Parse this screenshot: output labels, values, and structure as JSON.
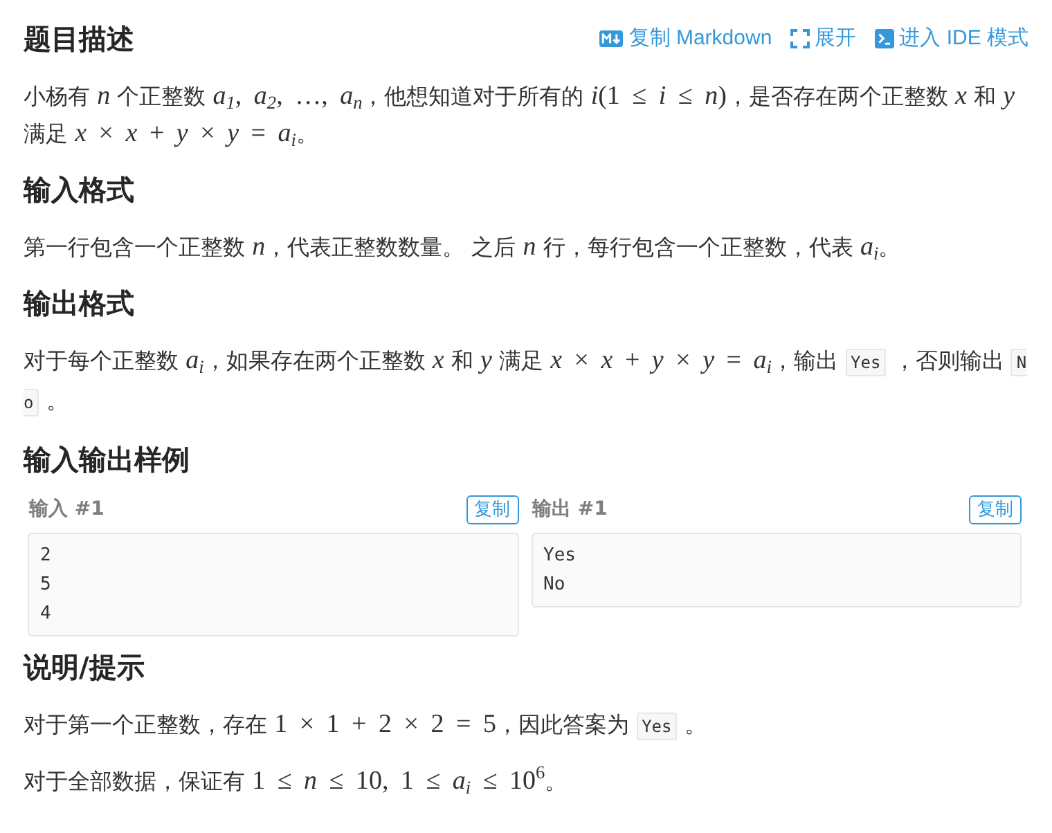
{
  "sections": [
    {
      "kind": "text",
      "title": "题目描述",
      "actions": [
        {
          "kind": "markdown",
          "label": "复制 Markdown"
        },
        {
          "kind": "expand",
          "label": "展开"
        },
        {
          "kind": "ide",
          "label": "进入 IDE 模式"
        }
      ],
      "paragraphs": [
        [
          {
            "kind": "text",
            "text": "小杨有 "
          },
          {
            "kind": "math",
            "text": "*n*"
          },
          {
            "kind": "text",
            "text": " 个正整数 "
          },
          {
            "kind": "math",
            "text": "*a*$_{1}$, *a*$_{2}$, …, *a*$_{n}$"
          },
          {
            "kind": "text",
            "text": "，他想知道对于所有的 "
          },
          {
            "kind": "math",
            "text": "*i*(1 ≤ *i* ≤ *n*)"
          },
          {
            "kind": "text",
            "text": "，是否存在两个正整数 "
          },
          {
            "kind": "math",
            "text": "*x*"
          },
          {
            "kind": "text",
            "text": " 和 "
          },
          {
            "kind": "math",
            "text": "*y*"
          },
          {
            "kind": "text",
            "text": " 满足 "
          },
          {
            "kind": "math",
            "text": "*x* × *x* + *y* × *y* = *a*$_{i}$"
          },
          {
            "kind": "text",
            "text": "。"
          }
        ]
      ]
    },
    {
      "kind": "text",
      "title": "输入格式",
      "paragraphs": [
        [
          {
            "kind": "text",
            "text": "第一行包含一个正整数 "
          },
          {
            "kind": "math",
            "text": "*n*"
          },
          {
            "kind": "text",
            "text": "，代表正整数数量。 之后 "
          },
          {
            "kind": "math",
            "text": "*n*"
          },
          {
            "kind": "text",
            "text": " 行，每行包含一个正整数，代表 "
          },
          {
            "kind": "math",
            "text": "*a*$_{i}$"
          },
          {
            "kind": "text",
            "text": "。"
          }
        ]
      ]
    },
    {
      "kind": "text",
      "title": "输出格式",
      "paragraphs": [
        [
          {
            "kind": "text",
            "text": "对于每个正整数 "
          },
          {
            "kind": "math",
            "text": "*a*$_{i}$"
          },
          {
            "kind": "text",
            "text": "，如果存在两个正整数 "
          },
          {
            "kind": "math",
            "text": "*x*"
          },
          {
            "kind": "text",
            "text": " 和 "
          },
          {
            "kind": "math",
            "text": "*y*"
          },
          {
            "kind": "text",
            "text": " 满足 "
          },
          {
            "kind": "math",
            "text": "*x* × *x* + *y* × *y* = *a*$_{i}$"
          },
          {
            "kind": "text",
            "text": "，输出 "
          },
          {
            "kind": "code",
            "text": "Yes"
          },
          {
            "kind": "text",
            "text": " ，否则输出 "
          },
          {
            "kind": "code",
            "text": "No"
          },
          {
            "kind": "text",
            "text": " 。"
          }
        ]
      ]
    },
    {
      "kind": "samples",
      "title": "输入输出样例",
      "samples": [
        {
          "input_label": "输入 #1",
          "input_copy": "复制",
          "input": [
            "2",
            "5",
            "4"
          ],
          "output_label": "输出 #1",
          "output_copy": "复制",
          "output": [
            "Yes",
            "No"
          ]
        }
      ]
    },
    {
      "kind": "text",
      "title": "说明/提示",
      "paragraphs": [
        [
          {
            "kind": "text",
            "text": "对于第一个正整数，存在 "
          },
          {
            "kind": "math",
            "text": "1 × 1 + 2 × 2 = 5"
          },
          {
            "kind": "text",
            "text": "，因此答案为 "
          },
          {
            "kind": "code",
            "text": "Yes"
          },
          {
            "kind": "text",
            "text": " 。"
          }
        ],
        [
          {
            "kind": "text",
            "text": "对于全部数据，保证有 "
          },
          {
            "kind": "math",
            "text": "1 ≤ *n* ≤ 10, 1 ≤ *a*$_{i}$ ≤ 10$^{6}$"
          },
          {
            "kind": "text",
            "text": "。"
          }
        ]
      ]
    }
  ]
}
